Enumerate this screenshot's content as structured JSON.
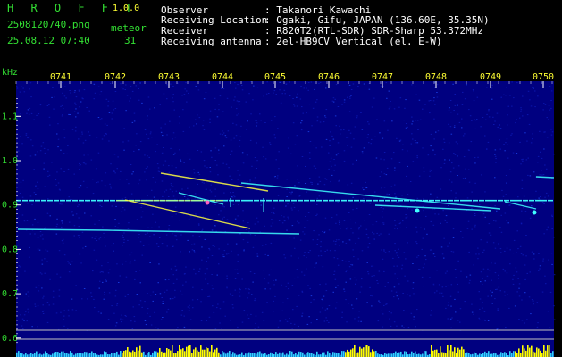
{
  "header": {
    "app_name": "H R O F F T",
    "version": "1.0.0",
    "filename": "2508120740.png",
    "datetime": "25.08.12 07:40",
    "meteor_label": "meteor",
    "meteor_count": "31",
    "info_labels": [
      "Observer",
      "Receiving Location",
      "Receiver",
      "Receiving antenna"
    ],
    "info_values": [
      ": Takanori Kawachi",
      ": Ogaki, Gifu, JAPAN (136.60E, 35.35N)",
      ": R820T2(RTL-SDR) SDR-Sharp 53.372MHz",
      ": 2el-HB9CV Vertical (el. E-W)"
    ]
  },
  "chart_data": {
    "type": "heatmap",
    "ylabel": "kHz",
    "yticks": [
      "1.1",
      "1.0",
      "0.9",
      "0.8",
      "0.7",
      "0.6"
    ],
    "ytick_values": [
      1.1,
      1.0,
      0.9,
      0.8,
      0.7,
      0.6
    ],
    "xticks": [
      "0741",
      "0742",
      "0743",
      "0744",
      "0745",
      "0746",
      "0747",
      "0748",
      "0749",
      "0750"
    ],
    "carrier_khz": 0.91,
    "colors": {
      "background": "#000080",
      "carrier": "#40ffff",
      "meteor": "#ffff40",
      "tick": "#ffffff",
      "level": "#ffff00"
    }
  }
}
